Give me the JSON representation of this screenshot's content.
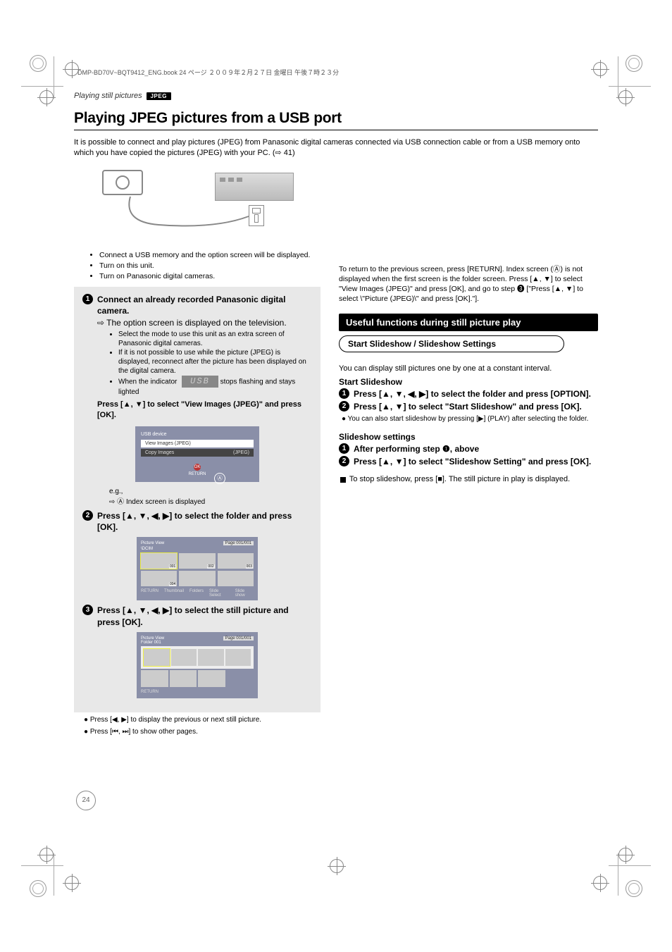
{
  "header": {
    "print_line": "DMP-BD70V~BQT9412_ENG.book  24 ページ  ２００９年２月２７日  金曜日  午後７時２３分",
    "page_number": "24"
  },
  "top": {
    "running_head": "Playing still pictures",
    "jpeg_badge": "JPEG",
    "title": "Playing JPEG pictures from a USB port",
    "intro": "It is possible to connect and play pictures (JPEG) from Panasonic digital cameras connected via USB connection cable or from a USB memory onto which you have copied the pictures (JPEG) with your PC. (⇨ 41)",
    "illus": {
      "camera_label": "Panasonic digital cameras"
    },
    "prep_bullets": [
      "Connect a USB memory and the option screen will be displayed.",
      "Turn on this unit.",
      "Turn on Panasonic digital cameras."
    ]
  },
  "steps": {
    "s1": {
      "text_a": "Connect an already recorded Panasonic digital camera.",
      "text_b": "⇨ The option screen is displayed on the television.",
      "bullets": [
        "Select the mode to use this unit as an extra screen of Panasonic digital cameras.",
        "If it is not possible to use while the picture (JPEG) is displayed, reconnect after the picture has been displayed on the digital camera."
      ],
      "usb_line_a": "When the indicator",
      "usb_line_b": "stops flashing and stays lighted",
      "sel_line": "Press [▲, ▼] to select \"View Images (JPEG)\" and press [OK].",
      "screen": {
        "title": "USB device",
        "row1_left": "View Images (JPEG)",
        "row2_left": "Copy Images",
        "row2_right": "(JPEG)",
        "ok": "OK",
        "footer_left": "RETURN"
      },
      "caption_a": "e.g.,",
      "caption_b": "Index screen is displayed",
      "callout_a": "Ⓐ"
    },
    "s2": {
      "text": "Press [▲, ▼, ◀, ▶] to select the folder and press [OK].",
      "thumb_screen": {
        "title": "Picture View",
        "path_label": "\\DCIM",
        "page": "Page 001/001",
        "thumbs": [
          "001",
          "002",
          "003",
          "004",
          "",
          ""
        ],
        "toolbar": [
          "RETURN",
          "Thumbnail",
          "Folders",
          "Slide Select",
          "Slide show"
        ]
      }
    },
    "s3": {
      "text": "Press [▲, ▼, ◀, ▶] to select the still picture and press [OK].",
      "strip_screen": {
        "title": "Picture View",
        "folder": "Folder 001",
        "page": "Page 001/001",
        "footer": "RETURN"
      }
    },
    "footnotes": [
      "Press [◀, ▶] to display the previous or next still picture.",
      "Press [⏮, ⏭] to show other pages."
    ]
  },
  "right": {
    "note": "To return to the previous screen, press [RETURN]. Index screen (Ⓐ) is not displayed when the first screen is the folder screen. Press [▲, ▼] to select \"View Images (JPEG)\" and press [OK], and go to step ❸ [\"Press [▲, ▼] to select \\\"Picture (JPEG)\\\" and press [OK].\"].",
    "black_bar": "Useful functions during still picture play",
    "pill": "Start Slideshow / Slideshow Settings",
    "intro": "You can display still pictures one by one at a constant interval.",
    "sub1_head": "Start Slideshow",
    "sub1_step1": "Press [▲, ▼, ◀, ▶] to select the folder and press [OPTION].",
    "sub1_step2": "Press [▲, ▼] to select \"Start Slideshow\" and press [OK].",
    "sub1_bullet": "You can also start slideshow by pressing [▶] (PLAY) after selecting the folder.",
    "sub2_head": "Slideshow settings",
    "sub2_step1": "After performing step ❶, above",
    "sub2_step2": "Press [▲, ▼] to select \"Slideshow Setting\" and press [OK].",
    "stop_line": "To stop slideshow, press [■]. The still picture in play is displayed."
  }
}
